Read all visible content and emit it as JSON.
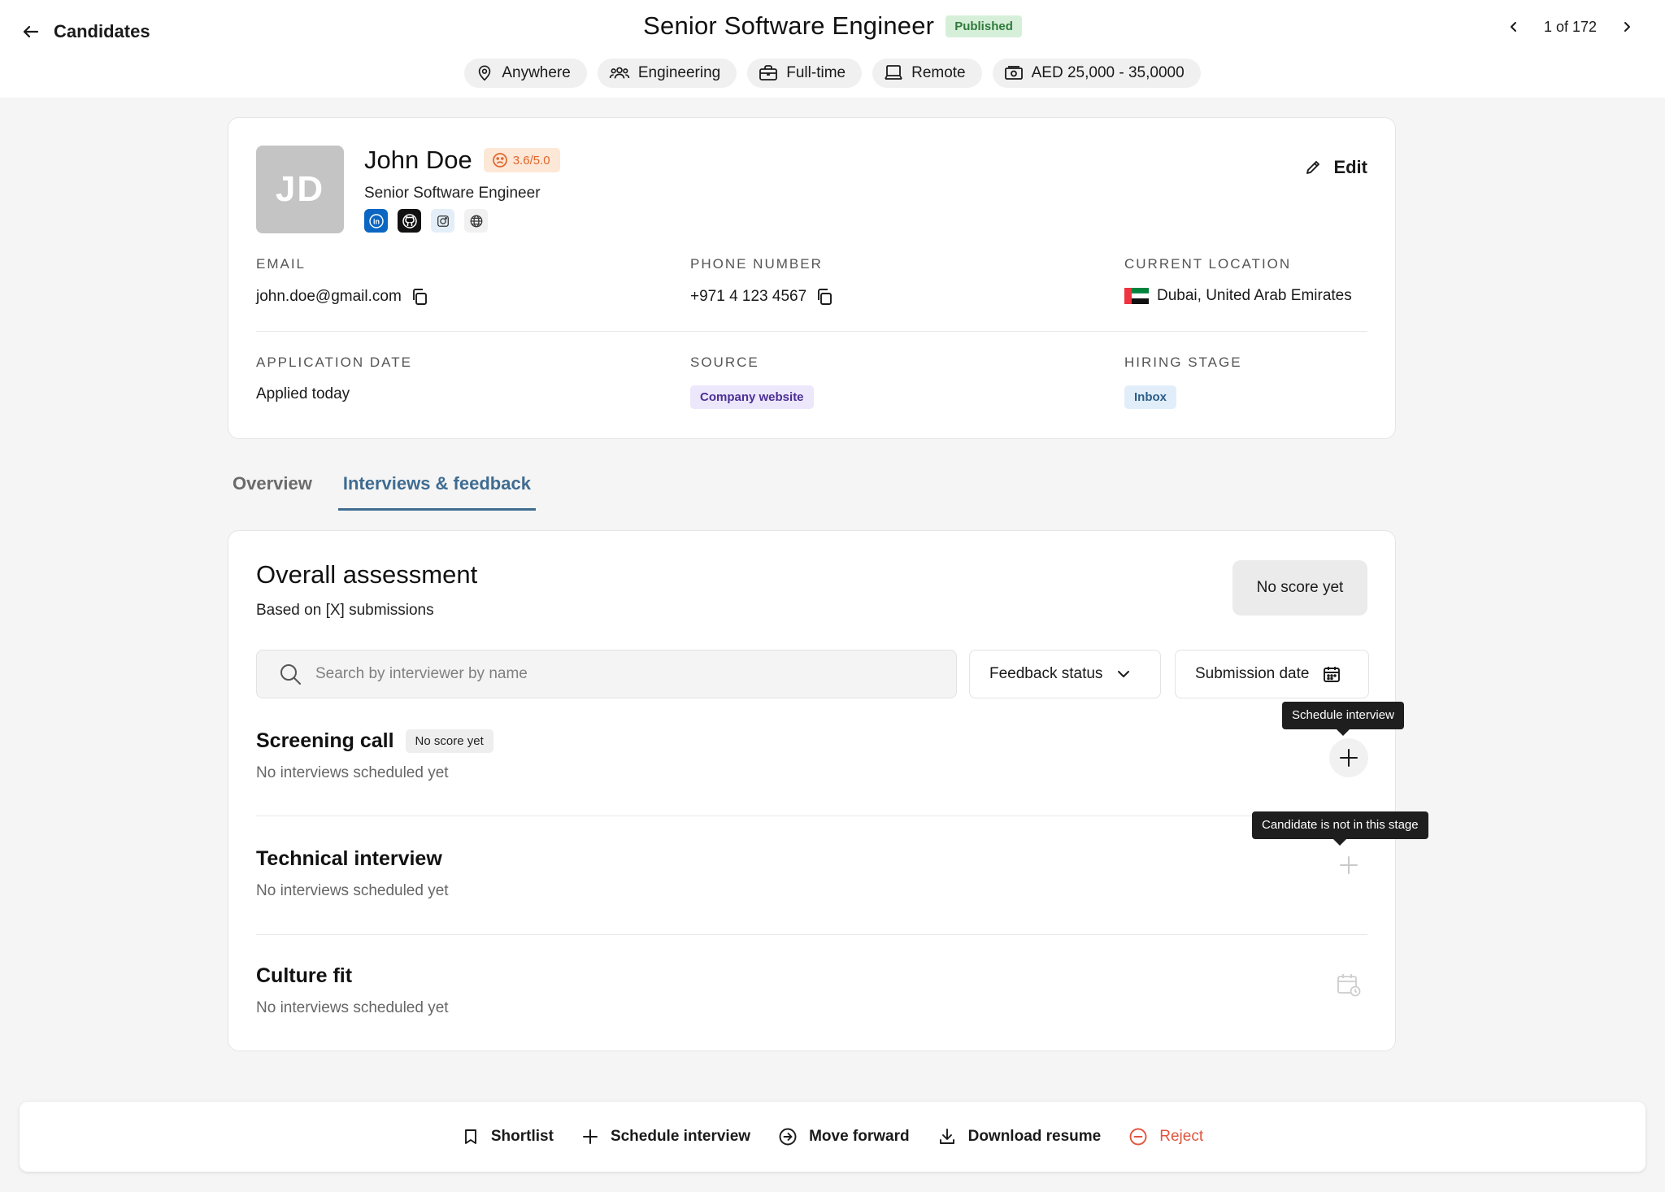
{
  "header": {
    "back_label": "Candidates",
    "job_title": "Senior Software Engineer",
    "status_badge": "Published",
    "pager": "1 of 172",
    "chips": {
      "location": "Anywhere",
      "department": "Engineering",
      "type": "Full-time",
      "workplace": "Remote",
      "salary": "AED 25,000 - 35,0000"
    }
  },
  "candidate": {
    "initials": "JD",
    "name": "John Doe",
    "rating": "3.6/5.0",
    "role": "Senior Software Engineer",
    "edit_label": "Edit",
    "fields": {
      "email_label": "EMAIL",
      "email": "john.doe@gmail.com",
      "phone_label": "PHONE NUMBER",
      "phone": "+971 4 123 4567",
      "location_label": "CURRENT LOCATION",
      "location": "Dubai, United Arab Emirates",
      "app_date_label": "APPLICATION DATE",
      "app_date": "Applied today",
      "source_label": "SOURCE",
      "source": "Company website",
      "stage_label": "HIRING STAGE",
      "stage": "Inbox"
    },
    "socials": [
      "linkedin-icon",
      "github-icon",
      "dribbble-icon",
      "website-icon"
    ]
  },
  "tabs": [
    "Overview",
    "Interviews & feedback"
  ],
  "assessment": {
    "title": "Overall assessment",
    "subtitle": "Based on [X] submissions",
    "score": "No score yet",
    "search_placeholder": "Search by interviewer by name",
    "filter_status": "Feedback status",
    "filter_date": "Submission date",
    "stages": [
      {
        "title": "Screening call",
        "badge": "No score yet",
        "subtitle": "No interviews scheduled yet",
        "tooltip": "Schedule interview"
      },
      {
        "title": "Technical interview",
        "subtitle": "No interviews scheduled yet",
        "tooltip": "Candidate is not in this stage"
      },
      {
        "title": "Culture fit",
        "subtitle": "No interviews scheduled yet"
      }
    ]
  },
  "actions": {
    "shortlist": "Shortlist",
    "schedule": "Schedule interview",
    "move": "Move forward",
    "download": "Download resume",
    "reject": "Reject"
  },
  "colors": {
    "accent": "#3f6c91",
    "published_bg": "#d6efd9",
    "published_text": "#2f7a3c",
    "rating": "#e0652a",
    "reject": "#e2553e"
  }
}
